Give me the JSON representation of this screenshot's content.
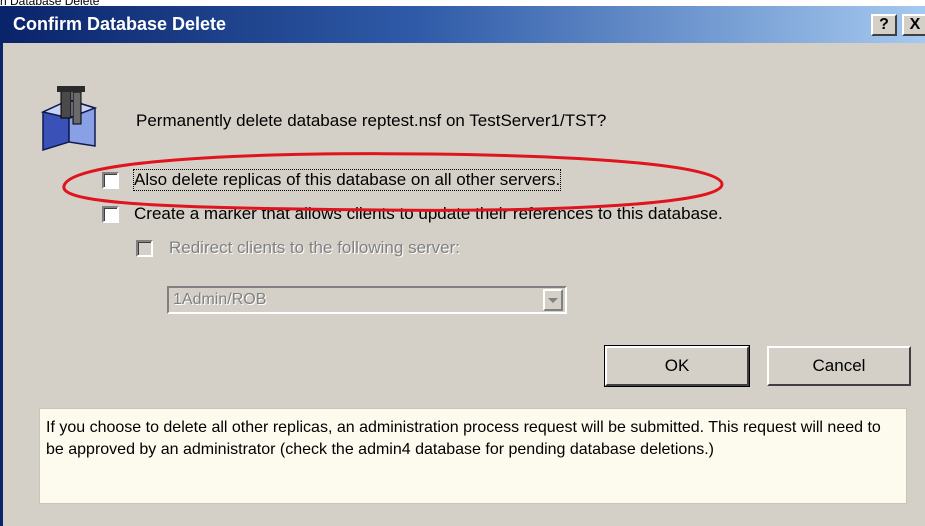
{
  "window_caption": "n Database Delete",
  "dialog": {
    "title": "Confirm Database Delete",
    "help_button": "?",
    "close_button": "X"
  },
  "prompt": "Permanently delete database reptest.nsf on TestServer1/TST?",
  "options": {
    "delete_replicas": {
      "label": "Also delete replicas of this database on all other servers.",
      "checked": false,
      "highlighted": true
    },
    "create_marker": {
      "label": "Create a marker that allows clients to update their references to this database.",
      "checked": false
    },
    "redirect_clients": {
      "label": "Redirect clients to the following server:",
      "checked": false,
      "enabled": false
    }
  },
  "server_select": {
    "value": "1Admin/ROB",
    "enabled": false
  },
  "buttons": {
    "ok": "OK",
    "cancel": "Cancel"
  },
  "info_text": "If you choose to delete all other replicas, an administration process request will be submitted. This request will need to be approved by an administrator (check the admin4 database for pending database deletions.)",
  "icons": {
    "app_icon": "database-delete-icon",
    "dropdown": "chevron-down-icon"
  },
  "colors": {
    "titlebar_start": "#0a246a",
    "titlebar_end": "#a6caf0",
    "dialog_bg": "#d4d0c8",
    "info_bg": "#fdfbee",
    "annotation": "#e0141e"
  }
}
